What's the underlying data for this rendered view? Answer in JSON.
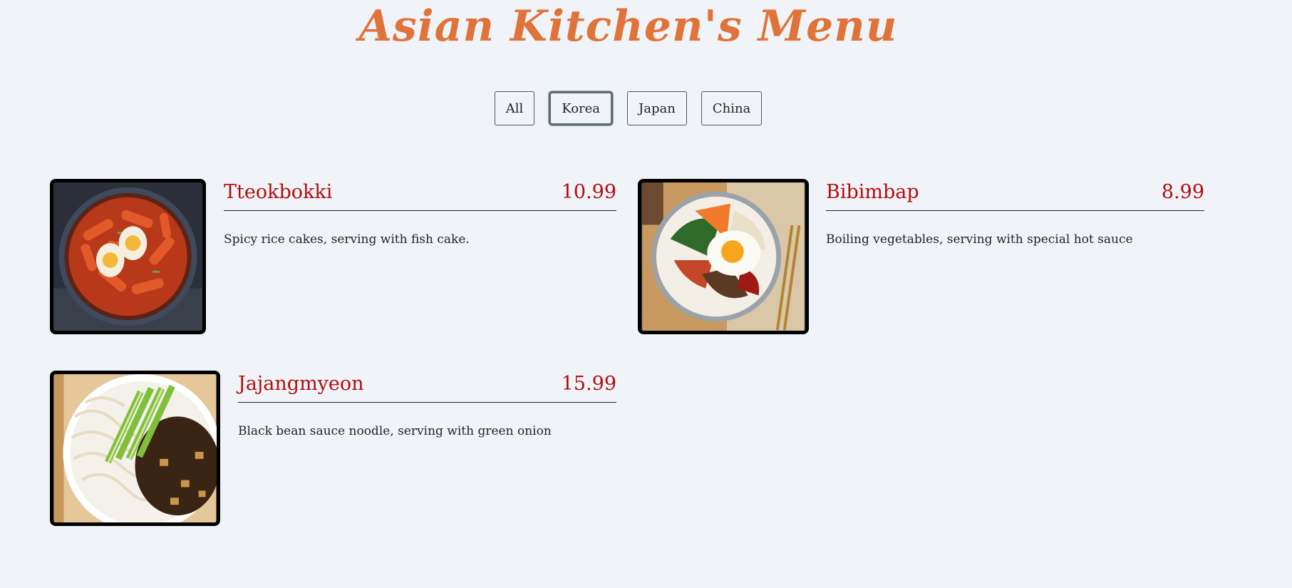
{
  "header": {
    "title": "Asian Kitchen's Menu"
  },
  "filters": {
    "all": "All",
    "korea": "Korea",
    "japan": "Japan",
    "china": "China",
    "active": "Korea"
  },
  "menu": [
    {
      "name": "Tteokbokki",
      "price": "10.99",
      "description": "Spicy rice cakes, serving with fish cake.",
      "image": "tteokbokki-bowl"
    },
    {
      "name": "Bibimbap",
      "price": "8.99",
      "description": "Boiling vegetables, serving with special hot sauce",
      "image": "bibimbap-bowl"
    },
    {
      "name": "Jajangmyeon",
      "price": "15.99",
      "description": "Black bean sauce noodle, serving with green onion",
      "image": "jajangmyeon-bowl"
    }
  ],
  "colors": {
    "title": "#e0733a",
    "accent": "#b30c0c",
    "background": "#f0f4f8"
  }
}
